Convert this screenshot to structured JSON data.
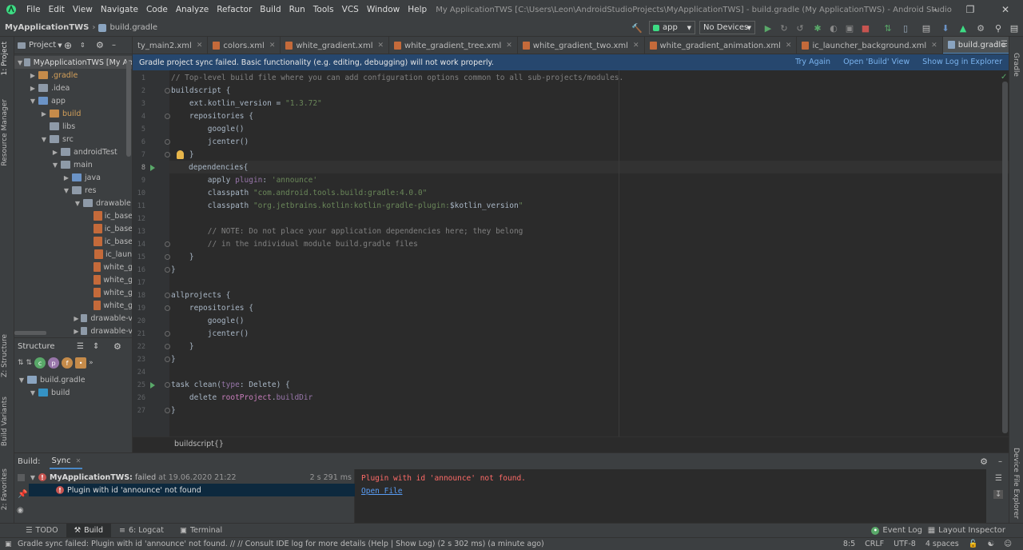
{
  "titlebar": {
    "menu": [
      "File",
      "Edit",
      "View",
      "Navigate",
      "Code",
      "Analyze",
      "Refactor",
      "Build",
      "Run",
      "Tools",
      "VCS",
      "Window",
      "Help"
    ],
    "title": "My ApplicationTWS [C:\\Users\\Leon\\AndroidStudioProjects\\MyApplicationTWS] - build.gradle (My ApplicationTWS) - Android Studio"
  },
  "navbar": {
    "project": "MyApplicationTWS",
    "file": "build.gradle",
    "run_config": "app",
    "device": "No Devices"
  },
  "left_tools": {
    "project": "1: Project",
    "resource_manager": "Resource Manager",
    "structure": "Z: Structure",
    "build_variants": "Build Variants",
    "favorites": "2: Favorites"
  },
  "right_tools": {
    "gradle": "Gradle",
    "device_file_explorer": "Device File Explorer"
  },
  "project_panel": {
    "title": "Project",
    "tree": [
      {
        "label": "MyApplicationTWS [My Ap",
        "depth": 0,
        "expanded": true,
        "type": "module"
      },
      {
        "label": ".gradle",
        "depth": 1,
        "expanded": false,
        "type": "folder-orange"
      },
      {
        "label": ".idea",
        "depth": 1,
        "expanded": false,
        "type": "folder"
      },
      {
        "label": "app",
        "depth": 1,
        "expanded": true,
        "type": "folder-blue"
      },
      {
        "label": "build",
        "depth": 2,
        "expanded": false,
        "type": "folder-orange"
      },
      {
        "label": "libs",
        "depth": 2,
        "expanded": null,
        "type": "folder"
      },
      {
        "label": "src",
        "depth": 2,
        "expanded": true,
        "type": "folder"
      },
      {
        "label": "androidTest",
        "depth": 3,
        "expanded": false,
        "type": "folder"
      },
      {
        "label": "main",
        "depth": 3,
        "expanded": true,
        "type": "folder"
      },
      {
        "label": "java",
        "depth": 4,
        "expanded": false,
        "type": "folder-blue"
      },
      {
        "label": "res",
        "depth": 4,
        "expanded": true,
        "type": "folder"
      },
      {
        "label": "drawable",
        "depth": 5,
        "expanded": true,
        "type": "folder"
      },
      {
        "label": "ic_base",
        "depth": 6,
        "expanded": null,
        "type": "xml"
      },
      {
        "label": "ic_base",
        "depth": 6,
        "expanded": null,
        "type": "xml"
      },
      {
        "label": "ic_base",
        "depth": 6,
        "expanded": null,
        "type": "xml"
      },
      {
        "label": "ic_laun",
        "depth": 6,
        "expanded": null,
        "type": "xml"
      },
      {
        "label": "white_g",
        "depth": 6,
        "expanded": null,
        "type": "xml"
      },
      {
        "label": "white_g",
        "depth": 6,
        "expanded": null,
        "type": "xml"
      },
      {
        "label": "white_g",
        "depth": 6,
        "expanded": null,
        "type": "xml"
      },
      {
        "label": "white_g",
        "depth": 6,
        "expanded": null,
        "type": "xml"
      },
      {
        "label": "drawable-v",
        "depth": 5,
        "expanded": false,
        "type": "folder"
      },
      {
        "label": "drawable-v",
        "depth": 5,
        "expanded": false,
        "type": "folder"
      }
    ]
  },
  "structure_panel": {
    "title": "Structure",
    "tree": [
      {
        "label": "build.gradle",
        "depth": 0
      },
      {
        "label": "build",
        "depth": 1
      }
    ]
  },
  "tabs": [
    {
      "label": "ty_main2.xml",
      "active": false,
      "icon": "xml"
    },
    {
      "label": "colors.xml",
      "active": false,
      "icon": "xml"
    },
    {
      "label": "white_gradient.xml",
      "active": false,
      "icon": "xml"
    },
    {
      "label": "white_gradient_tree.xml",
      "active": false,
      "icon": "xml"
    },
    {
      "label": "white_gradient_two.xml",
      "active": false,
      "icon": "xml"
    },
    {
      "label": "white_gradient_animation.xml",
      "active": false,
      "icon": "xml"
    },
    {
      "label": "ic_launcher_background.xml",
      "active": false,
      "icon": "xml"
    },
    {
      "label": "build.gradle (My ApplicationTWS)",
      "active": true,
      "icon": "gradle"
    }
  ],
  "banner": {
    "message": "Gradle project sync failed. Basic functionality (e.g. editing, debugging) will not work properly.",
    "try_again": "Try Again",
    "open_build_view": "Open 'Build' View",
    "show_log": "Show Log in Explorer"
  },
  "editor": {
    "current_line": 8,
    "lines": [
      [
        {
          "t": "// Top-level build file where you can add configuration options common to all sub-projects/modules.",
          "c": "cm"
        }
      ],
      [
        {
          "t": "buildscript {",
          "c": ""
        }
      ],
      [
        {
          "t": "    ext.kotlin_version = ",
          "c": ""
        },
        {
          "t": "\"1.3.72\"",
          "c": "st"
        }
      ],
      [
        {
          "t": "    repositories {",
          "c": ""
        }
      ],
      [
        {
          "t": "        google()",
          "c": ""
        }
      ],
      [
        {
          "t": "        jcenter()",
          "c": ""
        }
      ],
      [
        {
          "t": "    }",
          "c": ""
        }
      ],
      [
        {
          "t": "dependencies{",
          "c": ""
        }
      ],
      [
        {
          "t": "        apply ",
          "c": ""
        },
        {
          "t": "plugin",
          "c": "pu"
        },
        {
          "t": ": ",
          "c": ""
        },
        {
          "t": "'announce'",
          "c": "st"
        }
      ],
      [
        {
          "t": "        classpath ",
          "c": ""
        },
        {
          "t": "\"com.android.tools.build:gradle:4.0.0\"",
          "c": "st"
        }
      ],
      [
        {
          "t": "        classpath ",
          "c": ""
        },
        {
          "t": "\"org.jetbrains.kotlin:kotlin-gradle-plugin:",
          "c": "st"
        },
        {
          "t": "$kotlin_version",
          "c": ""
        },
        {
          "t": "\"",
          "c": "st"
        }
      ],
      [
        {
          "t": "",
          "c": ""
        }
      ],
      [
        {
          "t": "        // NOTE: Do not place your application dependencies here; they belong",
          "c": "cm"
        }
      ],
      [
        {
          "t": "        // in the individual module build.gradle files",
          "c": "cm"
        }
      ],
      [
        {
          "t": "    }",
          "c": ""
        }
      ],
      [
        {
          "t": "}",
          "c": ""
        }
      ],
      [
        {
          "t": "",
          "c": ""
        }
      ],
      [
        {
          "t": "allprojects {",
          "c": ""
        }
      ],
      [
        {
          "t": "    repositories {",
          "c": ""
        }
      ],
      [
        {
          "t": "        google()",
          "c": ""
        }
      ],
      [
        {
          "t": "        jcenter()",
          "c": ""
        }
      ],
      [
        {
          "t": "    }",
          "c": ""
        }
      ],
      [
        {
          "t": "}",
          "c": ""
        }
      ],
      [
        {
          "t": "",
          "c": ""
        }
      ],
      [
        {
          "t": "task clean(",
          "c": ""
        },
        {
          "t": "type",
          "c": "pu"
        },
        {
          "t": ": Delete) {",
          "c": ""
        }
      ],
      [
        {
          "t": "    delete ",
          "c": ""
        },
        {
          "t": "rootProject",
          "c": "kw2"
        },
        {
          "t": ".",
          "c": ""
        },
        {
          "t": "buildDir",
          "c": "pu"
        }
      ],
      [
        {
          "t": "}",
          "c": ""
        }
      ]
    ],
    "run_gutter_lines": [
      8,
      25
    ],
    "breadcrumb": "buildscript{}"
  },
  "build_panel": {
    "label": "Build:",
    "tab": "Sync",
    "rows": [
      {
        "title": "MyApplicationTWS:",
        "status": "failed",
        "time": "at 19.06.2020 21:22",
        "duration": "2 s 291 ms"
      },
      {
        "title": "Plugin with id 'announce' not found"
      }
    ],
    "output_error": "Plugin with id 'announce' not found.",
    "output_link": "Open File"
  },
  "bottom_tabs": [
    {
      "label": "TODO",
      "active": false
    },
    {
      "label": "Build",
      "active": true
    },
    {
      "label": "6: Logcat",
      "active": false
    },
    {
      "label": "Terminal",
      "active": false
    }
  ],
  "bottom_right": {
    "event_log": "Event Log",
    "layout_inspector": "Layout Inspector"
  },
  "statusbar": {
    "message": "Gradle sync failed: Plugin with id 'announce' not found. // // Consult IDE log for more details (Help | Show Log) (2 s 302 ms) (a minute ago)",
    "position": "8:5",
    "line_sep": "CRLF",
    "encoding": "UTF-8",
    "indent": "4 spaces"
  }
}
